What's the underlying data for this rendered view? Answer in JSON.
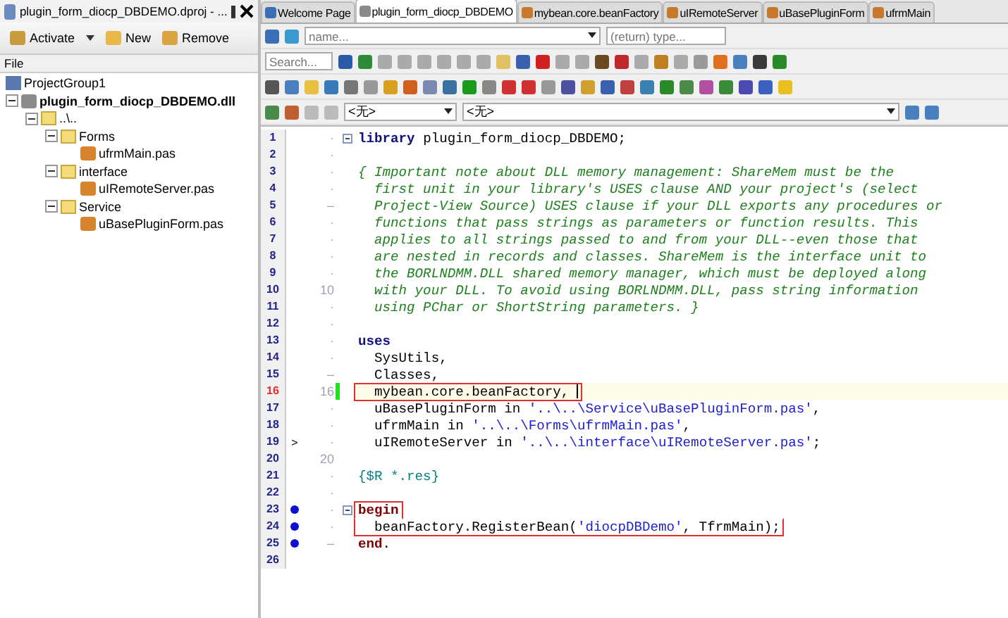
{
  "project_panel": {
    "title": "plugin_form_diocp_DBDEMO.dproj - ...",
    "buttons": [
      {
        "label": "Activate",
        "kind": "activate"
      },
      {
        "label": "New",
        "kind": "new"
      },
      {
        "label": "Remove",
        "kind": "remove"
      }
    ],
    "column_header": "File",
    "tree": [
      {
        "label": "ProjectGroup1",
        "kind": "group"
      },
      {
        "label": "plugin_form_diocp_DBDEMO.dll",
        "kind": "dll",
        "expanded": true,
        "children": [
          {
            "label": "..\\..",
            "kind": "folder",
            "expanded": true,
            "children": [
              {
                "label": "Forms",
                "kind": "folder",
                "expanded": true,
                "children": [
                  {
                    "label": "ufrmMain.pas",
                    "kind": "unit"
                  }
                ]
              },
              {
                "label": "interface",
                "kind": "folder",
                "expanded": true,
                "children": [
                  {
                    "label": "uIRemoteServer.pas",
                    "kind": "unit"
                  }
                ]
              },
              {
                "label": "Service",
                "kind": "folder",
                "expanded": true,
                "children": [
                  {
                    "label": "uBasePluginForm.pas",
                    "kind": "unit"
                  }
                ]
              }
            ]
          }
        ]
      }
    ]
  },
  "tabs": [
    {
      "label": "Welcome Page",
      "kind": "home",
      "selected": false
    },
    {
      "label": "plugin_form_diocp_DBDEMO",
      "kind": "project",
      "selected": true
    },
    {
      "label": "mybean.core.beanFactory",
      "kind": "unit",
      "selected": false
    },
    {
      "label": "uIRemoteServer",
      "kind": "unit",
      "selected": false
    },
    {
      "label": "uBasePluginForm",
      "kind": "unit",
      "selected": false
    },
    {
      "label": "ufrmMain",
      "kind": "unit",
      "selected": false
    }
  ],
  "navigator": {
    "name_placeholder": "name...",
    "type_placeholder": "(return) type...",
    "search_placeholder": "Search..."
  },
  "scope": {
    "left": "<无>",
    "right": "<无>"
  },
  "code": [
    {
      "number": "1",
      "gutter": "·",
      "fold_box": true,
      "segments": [
        {
          "kind": "keyword",
          "text": "library"
        },
        {
          "kind": "plain",
          "text": " plugin_form_diocp_DBDEMO;"
        }
      ]
    },
    {
      "number": "2",
      "gutter": "·"
    },
    {
      "number": "3",
      "gutter": "·",
      "segments": [
        {
          "kind": "comment",
          "text": "{ Important note about DLL memory management: ShareMem must be the"
        }
      ]
    },
    {
      "number": "4",
      "gutter": "·",
      "segments": [
        {
          "kind": "comment",
          "text": "  first unit in your library's USES clause AND your project's (select"
        }
      ]
    },
    {
      "number": "5",
      "gutter": "–",
      "segments": [
        {
          "kind": "comment",
          "text": "  Project-View Source) USES clause if your DLL exports any procedures or"
        }
      ]
    },
    {
      "number": "6",
      "gutter": "·",
      "segments": [
        {
          "kind": "comment",
          "text": "  functions that pass strings as parameters or function results. This"
        }
      ]
    },
    {
      "number": "7",
      "gutter": "·",
      "segments": [
        {
          "kind": "comment",
          "text": "  applies to all strings passed to and from your DLL--even those that"
        }
      ]
    },
    {
      "number": "8",
      "gutter": "·",
      "segments": [
        {
          "kind": "comment",
          "text": "  are nested in records and classes. ShareMem is the interface unit to"
        }
      ]
    },
    {
      "number": "9",
      "gutter": "·",
      "segments": [
        {
          "kind": "comment",
          "text": "  the BORLNDMM.DLL shared memory manager, which must be deployed along"
        }
      ]
    },
    {
      "number": "10",
      "gutter": "10",
      "segments": [
        {
          "kind": "comment",
          "text": "  with your DLL. To avoid using BORLNDMM.DLL, pass string information"
        }
      ]
    },
    {
      "number": "11",
      "gutter": "·",
      "segments": [
        {
          "kind": "comment",
          "text": "  using PChar or ShortString parameters. }"
        }
      ]
    },
    {
      "number": "12",
      "gutter": "·"
    },
    {
      "number": "13",
      "gutter": "·",
      "segments": [
        {
          "kind": "keyword",
          "text": "uses"
        }
      ]
    },
    {
      "number": "14",
      "gutter": "·",
      "segments": [
        {
          "kind": "plain",
          "text": "  SysUtils,"
        }
      ]
    },
    {
      "number": "15",
      "gutter": "–",
      "segments": [
        {
          "kind": "plain",
          "text": "  Classes,"
        }
      ]
    },
    {
      "number": "16",
      "gutter": "16",
      "current": true,
      "changed": true,
      "boxed": true,
      "segments": [
        {
          "kind": "plain",
          "text": "  mybean.core.beanFactory, "
        }
      ]
    },
    {
      "number": "17",
      "gutter": "·",
      "segments": [
        {
          "kind": "plain",
          "text": "  uBasePluginForm in "
        },
        {
          "kind": "string",
          "text": "'..\\..\\Service\\uBasePluginForm.pas'"
        },
        {
          "kind": "plain",
          "text": ","
        }
      ]
    },
    {
      "number": "18",
      "gutter": "·",
      "segments": [
        {
          "kind": "plain",
          "text": "  ufrmMain in "
        },
        {
          "kind": "string",
          "text": "'..\\..\\Forms\\ufrmMain.pas'"
        },
        {
          "kind": "plain",
          "text": ","
        }
      ]
    },
    {
      "number": "19",
      "gutter": "·",
      "mark": ">",
      "segments": [
        {
          "kind": "plain",
          "text": "  uIRemoteServer in "
        },
        {
          "kind": "string",
          "text": "'..\\..\\interface\\uIRemoteServer.pas'"
        },
        {
          "kind": "plain",
          "text": ";"
        }
      ]
    },
    {
      "number": "20",
      "gutter": "20"
    },
    {
      "number": "21",
      "gutter": "·",
      "segments": [
        {
          "kind": "directive",
          "text": "{$R *.res}"
        }
      ]
    },
    {
      "number": "22",
      "gutter": "·"
    },
    {
      "number": "23",
      "gutter": "·",
      "breakpoint": true,
      "fold_box": true,
      "boxed": true,
      "segments": [
        {
          "kind": "block",
          "text": "begin"
        }
      ]
    },
    {
      "number": "24",
      "gutter": "·",
      "breakpoint": true,
      "boxed": true,
      "segments": [
        {
          "kind": "plain",
          "text": "  beanFactory.RegisterBean("
        },
        {
          "kind": "string",
          "text": "'diocpDBDemo'"
        },
        {
          "kind": "plain",
          "text": ", TfrmMain);"
        }
      ]
    },
    {
      "number": "25",
      "gutter": "–",
      "breakpoint": true,
      "segments": [
        {
          "kind": "block",
          "text": "end"
        },
        {
          "kind": "plain",
          "text": "."
        }
      ]
    },
    {
      "number": "26"
    }
  ]
}
